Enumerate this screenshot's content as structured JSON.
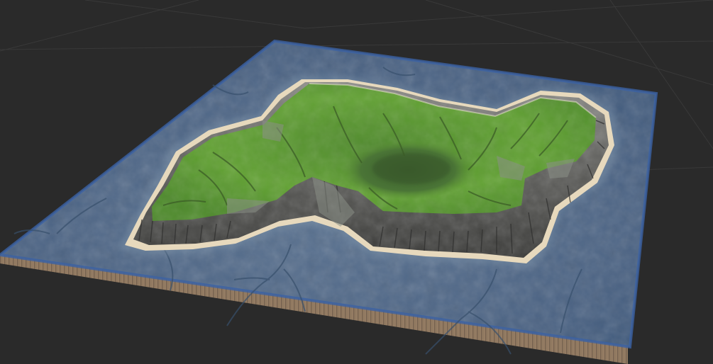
{
  "scene": {
    "kind": "3d-terrain-viewport",
    "subject": "island-heightmap",
    "colors": {
      "background": "#2a2a2a",
      "grid": "#3a3a3a",
      "water": "#4e6685",
      "water_deep": "#3f5673",
      "water_edge": "#3a5ea0",
      "sand": "#e9dcc2",
      "cliff": "#6a6a6a",
      "cliff_dark": "#3c3c3c",
      "grass": "#5f9a2f",
      "grass_dark": "#3f6f24",
      "crater": "#466f36",
      "base_side": "#b89a7a"
    }
  }
}
